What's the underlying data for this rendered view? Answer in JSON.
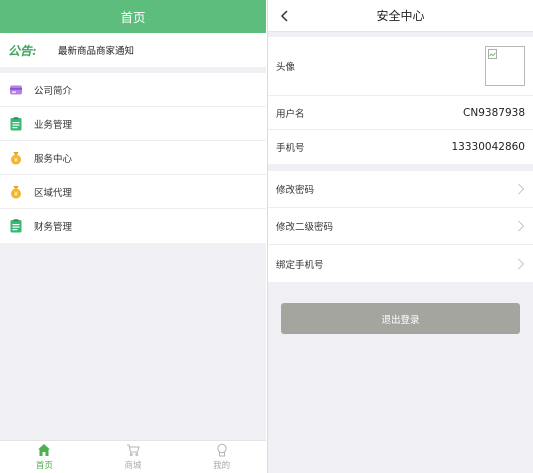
{
  "home": {
    "title": "首页",
    "notice": {
      "logo": "公告:",
      "text": "最新商品商家通知"
    },
    "menu": [
      {
        "label": "公司简介",
        "icon": "card-icon"
      },
      {
        "label": "业务管理",
        "icon": "document-icon"
      },
      {
        "label": "服务中心",
        "icon": "money-bag-icon"
      },
      {
        "label": "区域代理",
        "icon": "money-bag-icon"
      },
      {
        "label": "财务管理",
        "icon": "document-icon"
      }
    ],
    "tabs": [
      {
        "label": "首页",
        "icon": "home-icon",
        "active": true
      },
      {
        "label": "商城",
        "icon": "cart-icon",
        "active": false
      },
      {
        "label": "我的",
        "icon": "user-icon",
        "active": false
      }
    ]
  },
  "security": {
    "title": "安全中心",
    "avatar_label": "头像",
    "username": {
      "label": "用户名",
      "value": "CN9387938"
    },
    "phone": {
      "label": "手机号",
      "value": "13330042860"
    },
    "actions": [
      {
        "label": "修改密码"
      },
      {
        "label": "修改二级密码"
      },
      {
        "label": "绑定手机号"
      }
    ],
    "logout_label": "退出登录"
  },
  "colors": {
    "header_green": "#5dbd7d",
    "tab_active": "#4caf50",
    "logout_gray": "#a5a5a0",
    "background": "#efeff4"
  }
}
